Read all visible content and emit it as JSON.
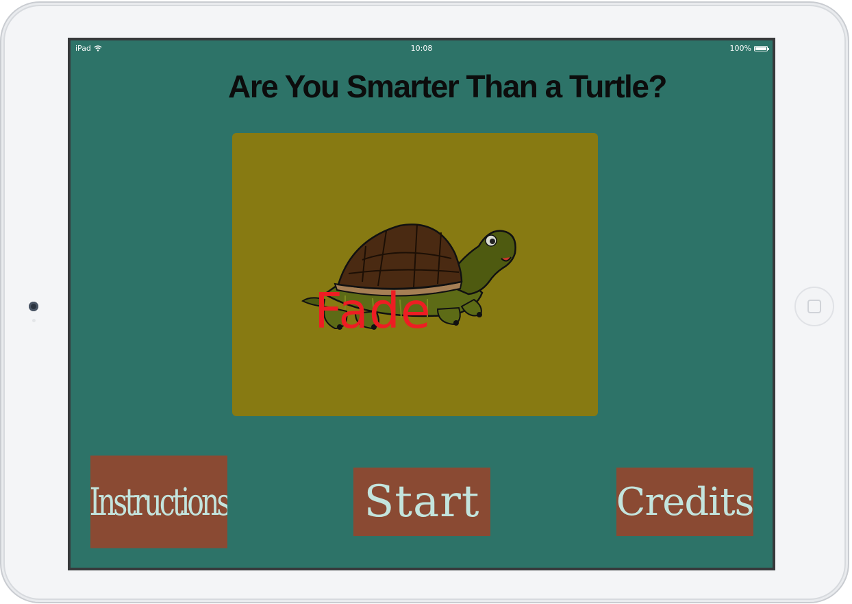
{
  "statusbar": {
    "device": "iPad",
    "time": "10:08",
    "battery": "100%"
  },
  "title": "Are You Smarter Than a Turtle?",
  "card": {
    "label": "Fade",
    "image": "turtle-illustration"
  },
  "buttons": {
    "instructions": "Instructions",
    "start": "Start",
    "credits": "Credits"
  },
  "colors": {
    "screen_bg": "#2d7368",
    "card_bg": "#877a12",
    "button_bg": "#8a4a33",
    "button_text": "#c3e4dd",
    "label_red": "#ee1d23"
  }
}
